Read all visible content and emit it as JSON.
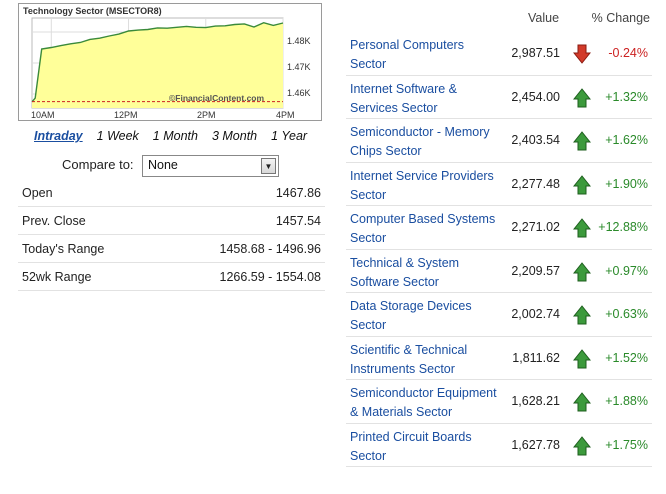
{
  "chart": {
    "title": "Technology Sector (MSECTOR8)",
    "watermark": "©FinancialContent.com",
    "x_ticks": [
      "10AM",
      "12PM",
      "2PM",
      "4PM"
    ],
    "y_ticks": [
      "1.48K",
      "1.47K",
      "1.46K"
    ]
  },
  "chart_data": {
    "type": "area",
    "title": "Technology Sector (MSECTOR8)",
    "xlabel": "",
    "ylabel": "",
    "x": [
      "9:30",
      "9:35",
      "9:45",
      "10:00",
      "10:15",
      "10:30",
      "10:45",
      "11:00",
      "11:15",
      "11:30",
      "11:45",
      "12:00",
      "12:15",
      "12:30",
      "12:45",
      "13:00",
      "13:15",
      "13:30",
      "13:45",
      "14:00",
      "14:15",
      "14:30",
      "14:45",
      "15:00",
      "15:15",
      "15:30",
      "15:45",
      "16:00"
    ],
    "values": [
      1457.5,
      1458.7,
      1474.5,
      1475.0,
      1475.6,
      1476.2,
      1476.6,
      1477.6,
      1478.0,
      1478.7,
      1479.3,
      1480.3,
      1480.6,
      1480.8,
      1481.3,
      1481.2,
      1481.5,
      1481.8,
      1481.5,
      1481.4,
      1481.9,
      1482.0,
      1482.4,
      1482.6,
      1481.6,
      1483.0,
      1482.1,
      1482.9
    ],
    "prev_close": 1457.54,
    "ylim": [
      1455.5,
      1484.5
    ],
    "y_ticks": [
      1460,
      1470,
      1480
    ],
    "grid": true
  },
  "ranges": [
    {
      "label": "Intraday",
      "active": true
    },
    {
      "label": "1 Week",
      "active": false
    },
    {
      "label": "1 Month",
      "active": false
    },
    {
      "label": "3 Month",
      "active": false
    },
    {
      "label": "1 Year",
      "active": false
    }
  ],
  "compare": {
    "label": "Compare to:",
    "selected": "None"
  },
  "stats": [
    {
      "label": "Open",
      "value": "1467.86"
    },
    {
      "label": "Prev. Close",
      "value": "1457.54"
    },
    {
      "label": "Today's Range",
      "value": "1458.68 - 1496.96"
    },
    {
      "label": "52wk Range",
      "value": "1266.59 - 1554.08"
    }
  ],
  "table": {
    "header_value": "Value",
    "header_change": "% Change",
    "rows": [
      {
        "name": "Personal Computers Sector",
        "value": "2,987.51",
        "change": "-0.24%",
        "dir": "down"
      },
      {
        "name": "Internet Software & Services Sector",
        "value": "2,454.00",
        "change": "+1.32%",
        "dir": "up"
      },
      {
        "name": "Semiconductor - Memory Chips Sector",
        "value": "2,403.54",
        "change": "+1.62%",
        "dir": "up"
      },
      {
        "name": "Internet Service Providers Sector",
        "value": "2,277.48",
        "change": "+1.90%",
        "dir": "up"
      },
      {
        "name": "Computer Based Systems Sector",
        "value": "2,271.02",
        "change": "+12.88%",
        "dir": "up"
      },
      {
        "name": "Technical & System Software Sector",
        "value": "2,209.57",
        "change": "+0.97%",
        "dir": "up"
      },
      {
        "name": "Data Storage Devices Sector",
        "value": "2,002.74",
        "change": "+0.63%",
        "dir": "up"
      },
      {
        "name": "Scientific & Technical Instruments Sector",
        "value": "1,811.62",
        "change": "+1.52%",
        "dir": "up"
      },
      {
        "name": "Semiconductor Equipment & Materials Sector",
        "value": "1,628.21",
        "change": "+1.88%",
        "dir": "up"
      },
      {
        "name": "Printed Circuit Boards Sector",
        "value": "1,627.78",
        "change": "+1.75%",
        "dir": "up"
      }
    ]
  },
  "colors": {
    "up": "#2a8a2a",
    "down": "#cc2222",
    "link": "#1a4ea0",
    "area_fill": "#ffff99",
    "line": "#3a8a3a"
  }
}
